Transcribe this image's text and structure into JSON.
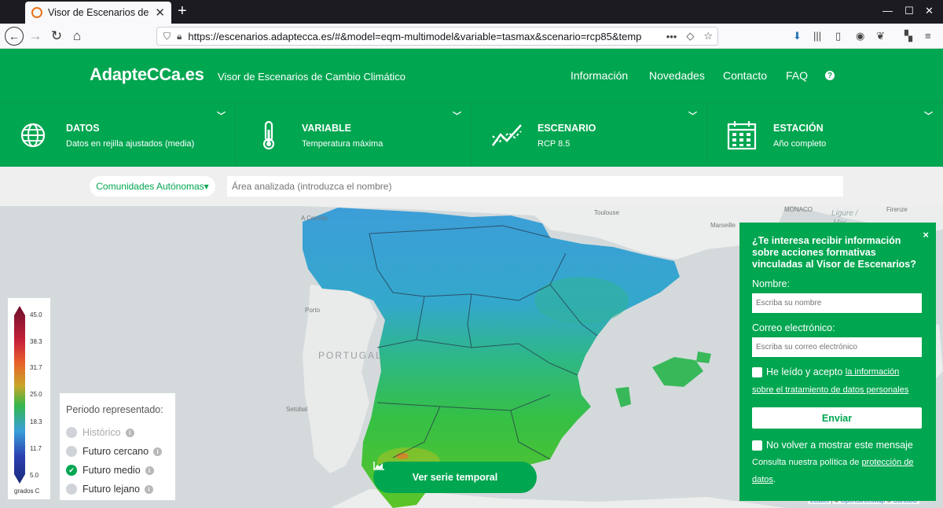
{
  "browser": {
    "tab_title": "Visor de Escenarios de C",
    "url": "https://escenarios.adaptecca.es/#&model=eqm-multimodel&variable=tasmax&scenario=rcp85&temp",
    "url_more": "•••"
  },
  "header": {
    "logo": "AdapteCCa.es",
    "subtitle": "Visor de Escenarios de Cambio Climático",
    "nav": [
      "Información",
      "Novedades",
      "Contacto",
      "FAQ"
    ],
    "help": "?"
  },
  "selectors": [
    {
      "title": "DATOS",
      "value": "Datos en rejilla ajustados (media)"
    },
    {
      "title": "VARIABLE",
      "value": "Temperatura máxima"
    },
    {
      "title": "ESCENARIO",
      "value": "RCP 8.5"
    },
    {
      "title": "ESTACIÓN",
      "value": "Año completo"
    }
  ],
  "search": {
    "region_select": "Comunidades Autónomas▾",
    "area_placeholder": "Área analizada (introduzca el nombre)"
  },
  "map": {
    "labels": {
      "portugal": "PORTUGAL",
      "liguria": "Ligure /",
      "liguria2": "Mer",
      "monaco": "MONACO",
      "toulouse": "Toulouse",
      "marseille": "Marseille",
      "porto": "Porto",
      "setubal": "Setúbal",
      "coruna": "A Coruña",
      "firenze": "Firenze"
    },
    "attribution": {
      "leaflet": "Leaflet",
      "sep": " | © ",
      "osm": "OpenStreetMap",
      "sep2": " © ",
      "carto": "CartoDB"
    }
  },
  "legend": {
    "ticks": [
      "45.0",
      "38.3",
      "31.7",
      "25.0",
      "18.3",
      "11.7",
      "5.0"
    ],
    "unit": "grados C",
    "colors": [
      "#6e0f2c",
      "#c8223a",
      "#e8622b",
      "#c8a62a",
      "#35b64a",
      "#3aa0d8",
      "#2a3fb0",
      "#1a2a7a"
    ]
  },
  "period": {
    "title": "Periodo representado:",
    "options": [
      {
        "label": "Histórico",
        "state": "disabled"
      },
      {
        "label": "Futuro cercano",
        "state": "off"
      },
      {
        "label": "Futuro medio",
        "state": "on"
      },
      {
        "label": "Futuro lejano",
        "state": "off"
      }
    ]
  },
  "serie_button": "Ver serie temporal",
  "popup": {
    "heading": "¿Te interesa recibir información sobre acciones formativas vinculadas al Visor de Escenarios?",
    "name_label": "Nombre:",
    "name_placeholder": "Escriba su nombre",
    "email_label": "Correo electrónico:",
    "email_placeholder": "Escriba su correo electrónico",
    "consent_text": "He leído y acepto",
    "consent_link1": "la información",
    "consent_link2": "sobre el tratamiento de datos personales",
    "send": "Enviar",
    "no_show": "No volver a mostrar este mensaje",
    "policy_text": "Consulta nuestra política de",
    "policy_link1": "protección de",
    "policy_link2": "datos",
    "policy_end": ".",
    "close": "×"
  }
}
